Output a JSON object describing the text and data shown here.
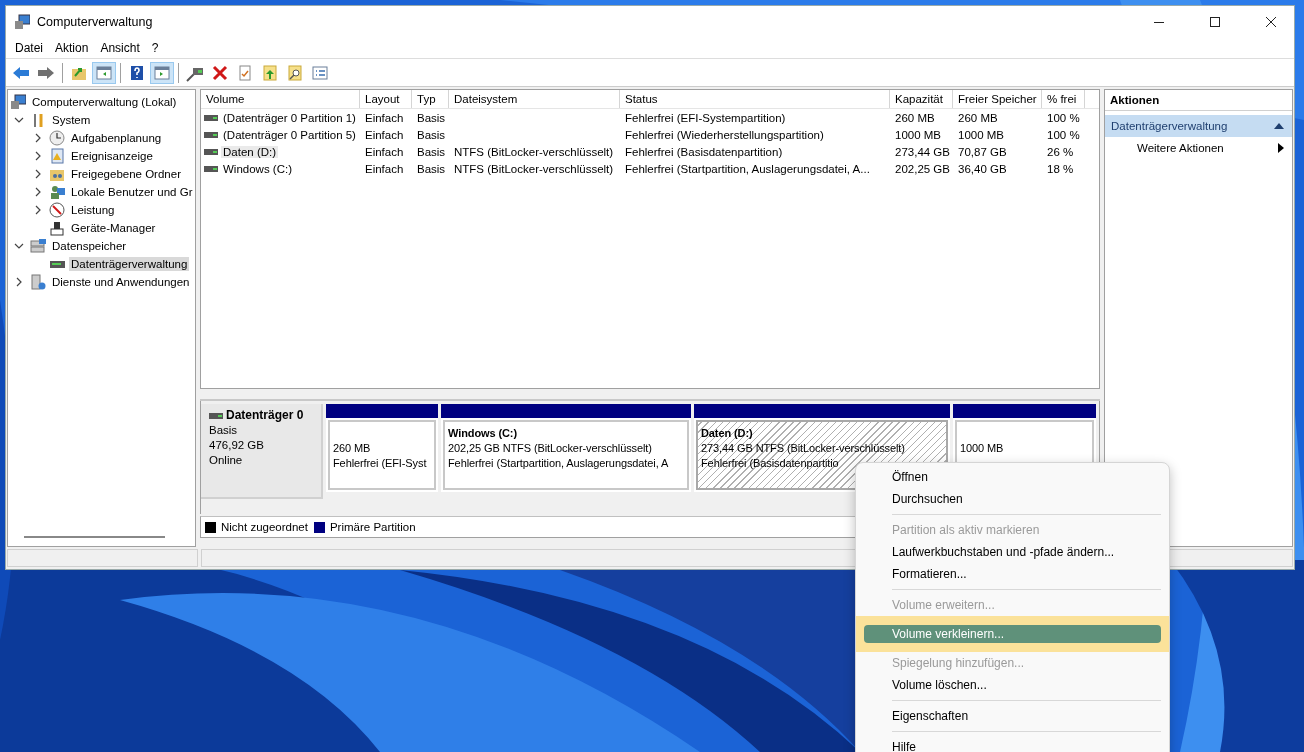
{
  "window": {
    "title": "Computerverwaltung"
  },
  "menu_bar": [
    "Datei",
    "Aktion",
    "Ansicht",
    "?"
  ],
  "toolbar": [
    {
      "kind": "button",
      "pressed": false
    },
    {
      "kind": "button",
      "pressed": false
    },
    {
      "kind": "separator"
    },
    {
      "kind": "button",
      "pressed": false
    },
    {
      "kind": "button",
      "pressed": true
    },
    {
      "kind": "separator"
    },
    {
      "kind": "button",
      "pressed": false
    },
    {
      "kind": "button",
      "pressed": true
    },
    {
      "kind": "separator"
    },
    {
      "kind": "button",
      "pressed": false
    },
    {
      "kind": "button",
      "pressed": false
    },
    {
      "kind": "button",
      "pressed": false
    },
    {
      "kind": "button",
      "pressed": false
    },
    {
      "kind": "button",
      "pressed": false
    },
    {
      "kind": "button",
      "pressed": false
    }
  ],
  "tree": [
    {
      "label": "Computerverwaltung (Lokal)",
      "selected": false,
      "children": [
        {
          "label": "System",
          "expanded": true,
          "selected": false,
          "children": [
            {
              "label": "Aufgabenplanung",
              "expanded": false,
              "selected": false
            },
            {
              "label": "Ereignisanzeige",
              "expanded": false,
              "selected": false
            },
            {
              "label": "Freigegebene Ordner",
              "expanded": false,
              "selected": false
            },
            {
              "label": "Lokale Benutzer und Gr",
              "expanded": false,
              "selected": false
            },
            {
              "label": "Leistung",
              "expanded": false,
              "selected": false
            },
            {
              "label": "Geräte-Manager",
              "selected": false
            }
          ]
        },
        {
          "label": "Datenspeicher",
          "expanded": true,
          "selected": false,
          "children": [
            {
              "label": "Datenträgerverwaltung",
              "selected": true
            }
          ]
        },
        {
          "label": "Dienste und Anwendungen",
          "expanded": false,
          "selected": false
        }
      ]
    }
  ],
  "table": {
    "columns": [
      "Volume",
      "Layout",
      "Typ",
      "Dateisystem",
      "Status",
      "Kapazität",
      "Freier Speicher",
      "% frei"
    ],
    "rows": [
      {
        "selected": false,
        "cells": [
          "(Datenträger 0 Partition 1)",
          "Einfach",
          "Basis",
          "",
          "Fehlerfrei (EFI-Systempartition)",
          "260 MB",
          "260 MB",
          "100 %"
        ]
      },
      {
        "selected": false,
        "cells": [
          "(Datenträger 0 Partition 5)",
          "Einfach",
          "Basis",
          "",
          "Fehlerfrei (Wiederherstellungspartition)",
          "1000 MB",
          "1000 MB",
          "100 %"
        ]
      },
      {
        "selected": true,
        "cells": [
          "Daten (D:)",
          "Einfach",
          "Basis",
          "NTFS (BitLocker-verschlüsselt)",
          "Fehlerfrei (Basisdatenpartition)",
          "273,44 GB",
          "70,87 GB",
          "26 %"
        ]
      },
      {
        "selected": false,
        "cells": [
          "Windows (C:)",
          "Einfach",
          "Basis",
          "NTFS (BitLocker-verschlüsselt)",
          "Fehlerfrei (Startpartition, Auslagerungsdatei, A...",
          "202,25 GB",
          "36,40 GB",
          "18 %"
        ]
      }
    ]
  },
  "disk": {
    "name": "Datenträger 0",
    "type": "Basis",
    "size": "476,92 GB",
    "status": "Online"
  },
  "partitions": [
    {
      "selected": false,
      "lines": [
        "260 MB",
        "Fehlerfrei (EFI-Syst"
      ]
    },
    {
      "selected": false,
      "title": "Windows  (C:)",
      "lines": [
        "202,25 GB NTFS (BitLocker-verschlüsselt)",
        "Fehlerfrei (Startpartition, Auslagerungsdatei, A"
      ]
    },
    {
      "selected": true,
      "title": "Daten  (D:)",
      "lines": [
        "273,44 GB NTFS (BitLocker-verschlüsselt)",
        "Fehlerfrei (Basisdatenpartitio"
      ]
    },
    {
      "selected": false,
      "lines": [
        "1000 MB"
      ]
    }
  ],
  "legend": [
    {
      "label": "Nicht zugeordnet",
      "color": "#000000"
    },
    {
      "label": "Primäre Partition",
      "color": "#000080"
    }
  ],
  "actions": {
    "title": "Aktionen",
    "section": {
      "label": "Datenträgerverwaltung",
      "expanded": true
    },
    "items": [
      "Weitere Aktionen"
    ]
  },
  "context_menu": [
    {
      "kind": "item",
      "label": "Öffnen",
      "disabled": false,
      "selected": false
    },
    {
      "kind": "item",
      "label": "Durchsuchen",
      "disabled": false,
      "selected": false
    },
    {
      "kind": "separator"
    },
    {
      "kind": "item",
      "label": "Partition als aktiv markieren",
      "disabled": true,
      "selected": false
    },
    {
      "kind": "item",
      "label": "Laufwerkbuchstaben und -pfade ändern...",
      "disabled": false,
      "selected": false
    },
    {
      "kind": "item",
      "label": "Formatieren...",
      "disabled": false,
      "selected": false
    },
    {
      "kind": "separator"
    },
    {
      "kind": "item",
      "label": "Volume erweitern...",
      "disabled": true,
      "selected": false
    },
    {
      "kind": "item",
      "label": "Volume verkleinern...",
      "disabled": false,
      "selected": true
    },
    {
      "kind": "item",
      "label": "Spiegelung hinzufügen...",
      "disabled": true,
      "selected": false
    },
    {
      "kind": "item",
      "label": "Volume löschen...",
      "disabled": false,
      "selected": false
    },
    {
      "kind": "separator"
    },
    {
      "kind": "item",
      "label": "Eigenschaften",
      "disabled": false,
      "selected": false
    },
    {
      "kind": "separator"
    },
    {
      "kind": "item",
      "label": "Hilfe",
      "disabled": false,
      "selected": false
    }
  ]
}
